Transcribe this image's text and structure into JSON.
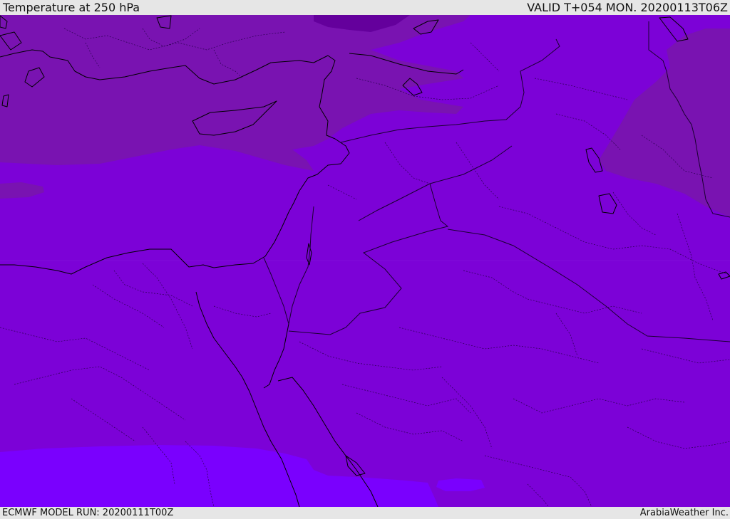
{
  "header": {
    "title": "Temperature at 250 hPa",
    "valid_time": "VALID T+054 MON. 20200113T06Z"
  },
  "footer": {
    "model_run": "ECMWF MODEL RUN: 20200111T00Z",
    "credit": "ArabiaWeather Inc."
  },
  "map": {
    "variable": "temperature",
    "level": "250 hPa",
    "colors": {
      "coldest": "#64009c",
      "cold": "#7913b1",
      "mid": "#7c02d7",
      "warmest": "#7a00fe",
      "coastline": "#000000",
      "border": "#1a0030"
    }
  }
}
